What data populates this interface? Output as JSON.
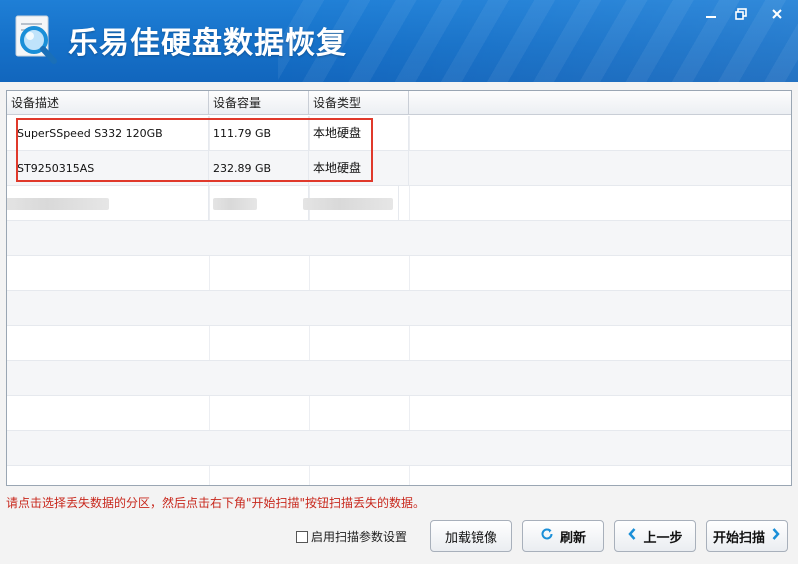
{
  "window": {
    "title": "乐易佳硬盘数据恢复",
    "icon": "magnifier-document-icon",
    "controls": [
      "minimize",
      "restore",
      "close"
    ]
  },
  "table": {
    "columns": [
      "设备描述",
      "设备容量",
      "设备类型"
    ],
    "rows": [
      {
        "description": "SuperSSpeed S332 120GB",
        "capacity": "111.79 GB",
        "type": "本地硬盘"
      },
      {
        "description": "ST9250315AS",
        "capacity": "232.89 GB",
        "type": "本地硬盘"
      }
    ]
  },
  "hint": "请点击选择丢失数据的分区，然后点击右下角\"开始扫描\"按钮扫描丢失的数据。",
  "footer": {
    "scan_params_label": "启用扫描参数设置",
    "scan_params_checked": false,
    "load_image_label": "加载镜像",
    "refresh_label": "刷新",
    "prev_label": "上一步",
    "start_scan_label": "开始扫描"
  },
  "colors": {
    "titlebar": "#1570c8",
    "hint": "#c8281d",
    "highlight": "#e0392b",
    "accent_icon": "#1a8fd8"
  }
}
